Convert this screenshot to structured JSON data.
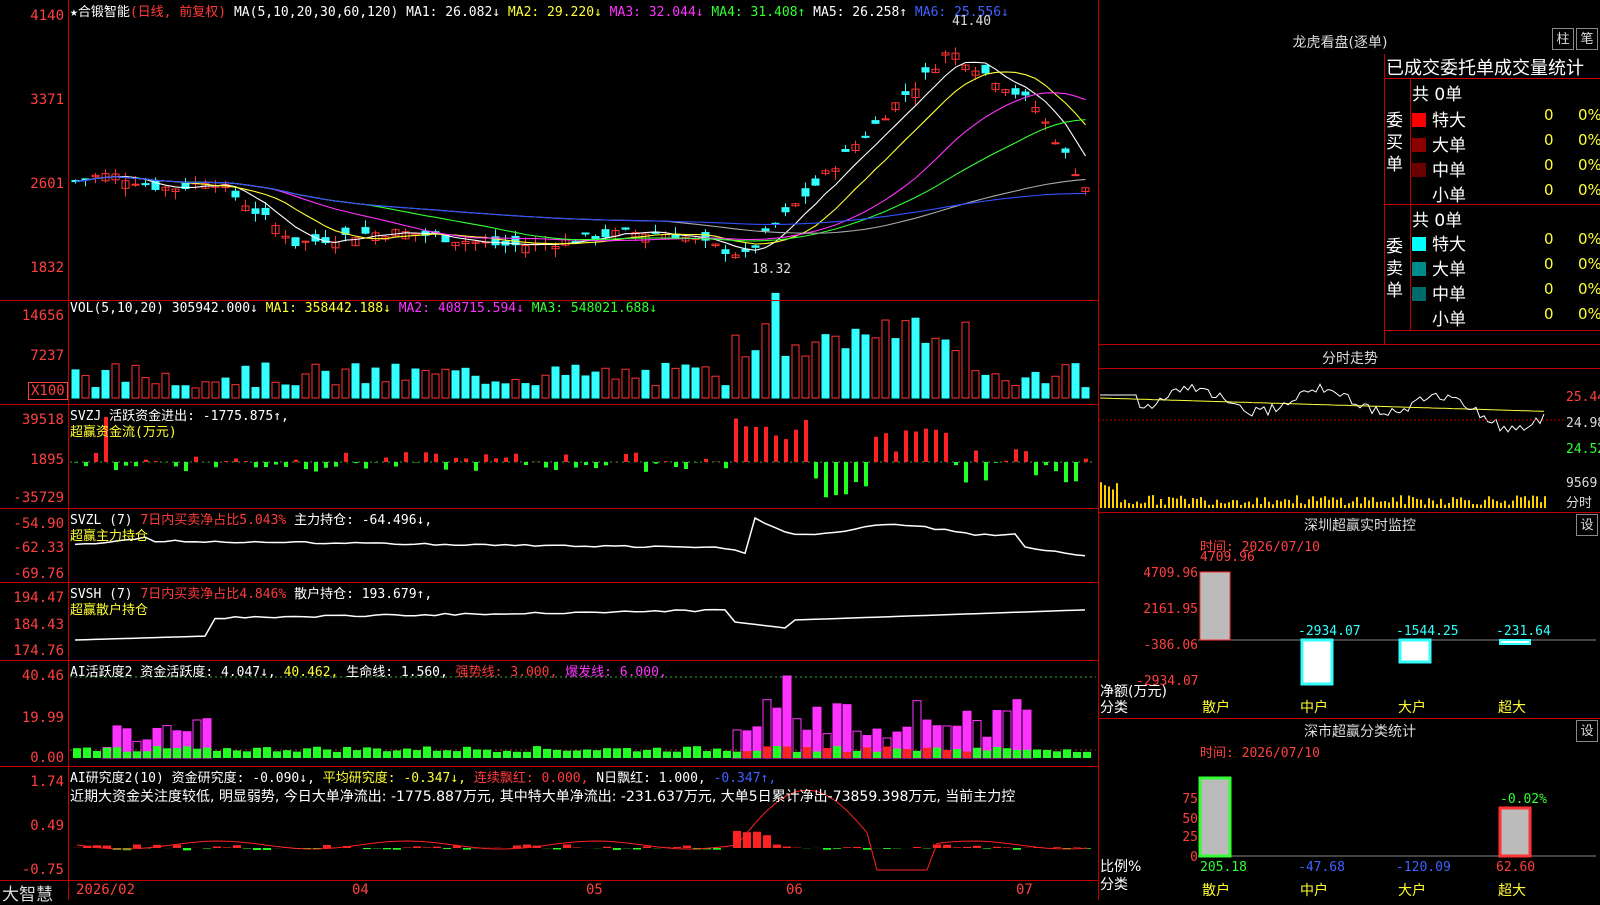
{
  "stock": {
    "name": "★合锻智能",
    "mode": "(日线, 前复权)"
  },
  "main_header": {
    "ma_label": "MA(5,10,20,30,60,120)",
    "ma1": "MA1: 26.082↓",
    "ma2": "MA2: 29.220↓",
    "ma3": "MA3: 32.044↓",
    "ma4": "MA4: 31.408↑",
    "ma5": "MA5: 26.258↑",
    "ma6": "MA6: 25.556↓"
  },
  "price_axis": [
    "4140",
    "3371",
    "2601",
    "1832"
  ],
  "price_marks": {
    "high": "41.40",
    "low": "18.32"
  },
  "vol_header": {
    "label": "VOL(5,10,20)",
    "vol": "305942.000↓",
    "ma1": "MA1: 358442.188↓",
    "ma2": "MA2: 408715.594↓",
    "ma3": "MA3: 548021.688↓"
  },
  "vol_axis": [
    "14656",
    "7237"
  ],
  "vol_unit": "X100",
  "svzj": {
    "label": "SVZJ",
    "value": "活跃资金进出: -1775.875↑,",
    "sub": "超赢资金流(万元)",
    "axis": [
      "39518",
      "1895",
      "-35729"
    ]
  },
  "svzl": {
    "label": "SVZL (7)",
    "ratio": "7日内买卖净占比5.043%",
    "value": "主力持仓: -64.496↓,",
    "sub": "超赢主力持仓",
    "axis": [
      "-54.90",
      "-62.33",
      "-69.76"
    ]
  },
  "svsh": {
    "label": "SVSH (7)",
    "ratio": "7日内买卖净占比4.846%",
    "value": "散户持仓: 193.679↑,",
    "sub": "超赢散户持仓",
    "axis": [
      "194.47",
      "184.43",
      "174.76"
    ]
  },
  "ai2": {
    "label": "AI活跃度2",
    "v1": "资金活跃度: 4.047↓,",
    "v2": "40.462,",
    "v3": "生命线: 1.560,",
    "v4": "强势线: 3.000,",
    "v5": "爆发线: 6.000,",
    "axis": [
      "40.46",
      "19.99",
      "0.00"
    ]
  },
  "ai_research": {
    "label": "AI研究度2(10)",
    "v1": "资金研究度: -0.090↓,",
    "v2": "平均研究度: -0.347↓,",
    "v3": "连续飘红: 0.000,",
    "v4": "N日飘红: 1.000,",
    "v5": "-0.347↑,",
    "text": "近期大资金关注度较低, 明显弱势, 今日大单净流出: -1775.887万元, 其中特大单净流出: -231.637万元, 大单5日累计净出-73859.398万元, 当前主力控",
    "axis": [
      "1.74",
      "0.49",
      "-0.75"
    ]
  },
  "time_axis": [
    "2026/02",
    "04",
    "05",
    "06",
    "07"
  ],
  "brand": "大智慧",
  "right": {
    "lhb_title": "龙虎看盘(逐单)",
    "btn_zhu": "柱",
    "btn_bi": "笔",
    "order_title": "已成交委托单成交量统计",
    "buy": {
      "side": "委买单",
      "total": "共 0单",
      "rows": [
        {
          "label": "特大",
          "count": "0",
          "pct": "0%",
          "color": "#ff0000"
        },
        {
          "label": "大单",
          "count": "0",
          "pct": "0%",
          "color": "#8b0000"
        },
        {
          "label": "中单",
          "count": "0",
          "pct": "0%",
          "color": "#6b0000"
        },
        {
          "label": "小单",
          "count": "0",
          "pct": "0%",
          "color": "#000000"
        }
      ]
    },
    "sell": {
      "side": "委卖单",
      "total": "共 0单",
      "rows": [
        {
          "label": "特大",
          "count": "0",
          "pct": "0%",
          "color": "#00ffff"
        },
        {
          "label": "大单",
          "count": "0",
          "pct": "0%",
          "color": "#008b8b"
        },
        {
          "label": "中单",
          "count": "0",
          "pct": "0%",
          "color": "#006b6b"
        },
        {
          "label": "小单",
          "count": "0",
          "pct": "0%",
          "color": "#000000"
        }
      ]
    },
    "intraday": {
      "title": "分时走势",
      "axis": [
        "25.44",
        "24.98",
        "24.52"
      ],
      "vol": "9569",
      "vol_label": "分时"
    },
    "monitor": {
      "title": "深圳超赢实时监控",
      "btn": "设",
      "time": "时间: 2026/07/10",
      "axis": [
        "4709.96",
        "2161.95",
        "-386.06",
        "-2934.07"
      ],
      "unit": "净额(万元)",
      "cat_label": "分类",
      "cats": [
        "散户",
        "中户",
        "大户",
        "超大"
      ],
      "values": [
        "4709.96",
        "-2934.07",
        "-1544.25",
        "-231.64"
      ]
    },
    "classify": {
      "title": "深市超赢分类统计",
      "btn": "设",
      "time": "时间: 2026/07/10",
      "axis": [
        "75",
        "50",
        "25",
        "0"
      ],
      "unit": "比例%",
      "cat_label": "分类",
      "cats": [
        "散户",
        "中户",
        "大户",
        "超大"
      ],
      "values": [
        "205.18",
        "-47.68",
        "-120.09",
        "62.60"
      ],
      "top": "-0.02%"
    }
  }
}
